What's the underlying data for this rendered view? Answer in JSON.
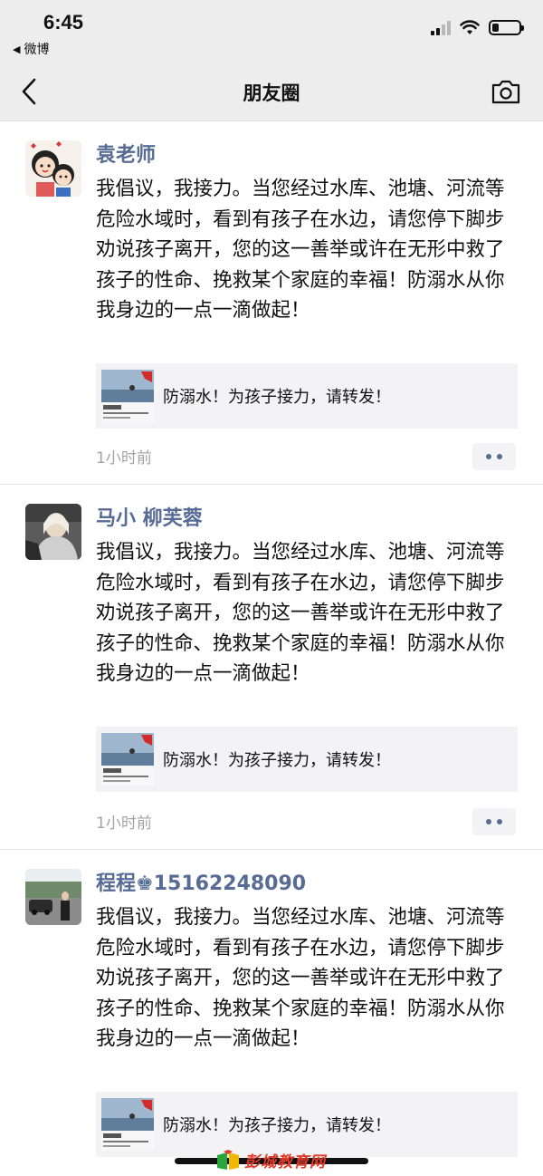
{
  "status_bar": {
    "time": "6:45",
    "back_app_label": "微博",
    "signal_icon": "cellular-signal-icon",
    "wifi_icon": "wifi-icon",
    "battery_icon": "battery-icon",
    "battery_level": 0.25
  },
  "nav": {
    "title": "朋友圈",
    "back_icon": "chevron-left-icon",
    "camera_icon": "camera-icon"
  },
  "posts": [
    {
      "name": "袁老师",
      "text": "我倡议，我接力。当您经过水库、池塘、河流等危险水域时，看到有孩子在水边，请您停下脚步劝说孩子离开，您的这一善举或许在无形中救了孩子的性命、挽救某个家庭的幸福！防溺水从你我身边的一点一滴做起！",
      "link_title": "防溺水！为孩子接力，请转发！",
      "time": "1小时前"
    },
    {
      "name": "马小 柳芙蓉",
      "text": "我倡议，我接力。当您经过水库、池塘、河流等危险水域时，看到有孩子在水边，请您停下脚步劝说孩子离开，您的这一善举或许在无形中救了孩子的性命、挽救某个家庭的幸福！防溺水从你我身边的一点一滴做起！",
      "link_title": "防溺水！为孩子接力，请转发！",
      "time": "1小时前"
    },
    {
      "name": "程程♚15162248090",
      "text": "我倡议，我接力。当您经过水库、池塘、河流等危险水域时，看到有孩子在水边，请您停下脚步劝说孩子离开，您的这一善举或许在无形中救了孩子的性命、挽救某个家庭的幸福！防溺水从你我身边的一点一滴做起！",
      "link_title": "防溺水！为孩子接力，请转发！",
      "time": ""
    }
  ],
  "watermark": "彭城教育网",
  "colors": {
    "name_link": "#576b95",
    "bar_bg": "#ededed",
    "card_bg": "#f3f3f5",
    "time_text": "#a3a3a3",
    "watermark": "#e03a2a"
  }
}
